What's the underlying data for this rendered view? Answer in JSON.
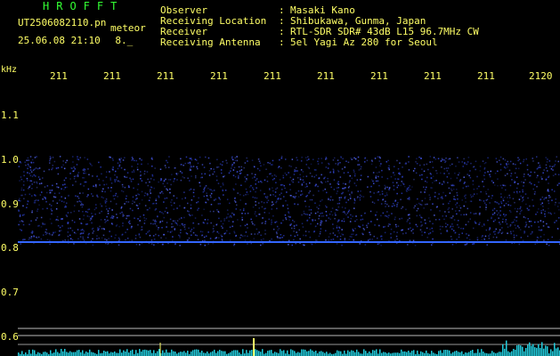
{
  "header": {
    "app_title": "HROFFT",
    "filename": "UT2506082110.pn",
    "meteor_tag": "meteor",
    "datetime": "25.06.08 21:10",
    "datetime_suffix": "8._"
  },
  "info": {
    "labels": [
      "Observer",
      "Receiving Location",
      "Receiver",
      "Receiving Antenna"
    ],
    "colons": [
      ":",
      ":",
      ":",
      ":"
    ],
    "values": [
      "Masaki Kano",
      "Shibukawa, Gunma, Japan",
      "RTL-SDR SDR# 43dB L15 96.7MHz CW",
      "5el Yagi Az 280 for Seoul"
    ]
  },
  "axis": {
    "y_unit": "kHz",
    "x_ticks": [
      "211",
      "211",
      "211",
      "211",
      "211",
      "211",
      "211",
      "211",
      "211",
      "2120"
    ],
    "y_ticks": [
      "1.1",
      "1.0",
      "0.9",
      "0.8",
      "0.7",
      "0.6"
    ]
  },
  "colors": {
    "background": "#000000",
    "header_text": "#ffffff",
    "accent_yellow": "#ffff66",
    "title_green": "#33ff33",
    "noise_blue": "#2233aa",
    "signal_line": "#3366ff",
    "level_bars": "#22ccdd"
  }
}
